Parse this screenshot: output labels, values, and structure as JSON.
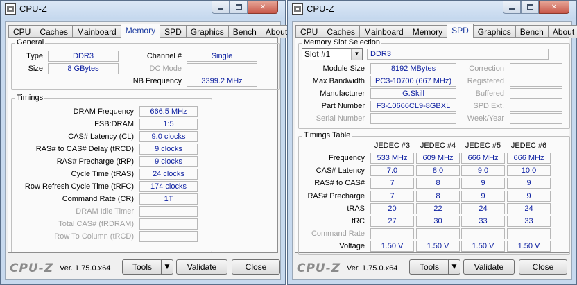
{
  "left_window": {
    "title": "CPU-Z",
    "tabs": [
      "CPU",
      "Caches",
      "Mainboard",
      "Memory",
      "SPD",
      "Graphics",
      "Bench",
      "About"
    ],
    "general": {
      "title": "General",
      "type_label": "Type",
      "type_value": "DDR3",
      "size_label": "Size",
      "size_value": "8 GBytes",
      "channel_label": "Channel #",
      "channel_value": "Single",
      "dcmode_label": "DC Mode",
      "dcmode_value": "",
      "nbfreq_label": "NB Frequency",
      "nbfreq_value": "3399.2 MHz"
    },
    "timings": {
      "title": "Timings",
      "rows": [
        {
          "label": "DRAM Frequency",
          "value": "666.5 MHz",
          "dim": false
        },
        {
          "label": "FSB:DRAM",
          "value": "1:5",
          "dim": false
        },
        {
          "label": "CAS# Latency (CL)",
          "value": "9.0 clocks",
          "dim": false
        },
        {
          "label": "RAS# to CAS# Delay (tRCD)",
          "value": "9 clocks",
          "dim": false
        },
        {
          "label": "RAS# Precharge (tRP)",
          "value": "9 clocks",
          "dim": false
        },
        {
          "label": "Cycle Time (tRAS)",
          "value": "24 clocks",
          "dim": false
        },
        {
          "label": "Row Refresh Cycle Time (tRFC)",
          "value": "174 clocks",
          "dim": false
        },
        {
          "label": "Command Rate (CR)",
          "value": "1T",
          "dim": false
        },
        {
          "label": "DRAM Idle Timer",
          "value": "",
          "dim": true
        },
        {
          "label": "Total CAS# (tRDRAM)",
          "value": "",
          "dim": true
        },
        {
          "label": "Row To Column (tRCD)",
          "value": "",
          "dim": true
        }
      ]
    },
    "footer": {
      "logo": "CPU-Z",
      "version": "Ver. 1.75.0.x64",
      "tools": "Tools",
      "validate": "Validate",
      "close": "Close"
    }
  },
  "right_window": {
    "title": "CPU-Z",
    "tabs": [
      "CPU",
      "Caches",
      "Mainboard",
      "Memory",
      "SPD",
      "Graphics",
      "Bench",
      "About"
    ],
    "slot_group": {
      "title": "Memory Slot Selection",
      "slot_selected": "Slot #1",
      "slot_type": "DDR3",
      "rows": [
        {
          "label": "Module Size",
          "value": "8192 MBytes",
          "dim": false,
          "rlabel": "Correction",
          "rvalue": ""
        },
        {
          "label": "Max Bandwidth",
          "value": "PC3-10700 (667 MHz)",
          "dim": false,
          "rlabel": "Registered",
          "rvalue": ""
        },
        {
          "label": "Manufacturer",
          "value": "G.Skill",
          "dim": false,
          "rlabel": "Buffered",
          "rvalue": ""
        },
        {
          "label": "Part Number",
          "value": "F3-10666CL9-8GBXL",
          "dim": false,
          "rlabel": "SPD Ext.",
          "rvalue": ""
        },
        {
          "label": "Serial Number",
          "value": "",
          "dim": true,
          "rlabel": "Week/Year",
          "rvalue": ""
        }
      ]
    },
    "timings_table": {
      "title": "Timings Table",
      "columns": [
        "JEDEC #3",
        "JEDEC #4",
        "JEDEC #5",
        "JEDEC #6"
      ],
      "rows": [
        {
          "label": "Frequency",
          "dim": false,
          "values": [
            "533 MHz",
            "609 MHz",
            "666 MHz",
            "666 MHz"
          ]
        },
        {
          "label": "CAS# Latency",
          "dim": false,
          "values": [
            "7.0",
            "8.0",
            "9.0",
            "10.0"
          ]
        },
        {
          "label": "RAS# to CAS#",
          "dim": false,
          "values": [
            "7",
            "8",
            "9",
            "9"
          ]
        },
        {
          "label": "RAS# Precharge",
          "dim": false,
          "values": [
            "7",
            "8",
            "9",
            "9"
          ]
        },
        {
          "label": "tRAS",
          "dim": false,
          "values": [
            "20",
            "22",
            "24",
            "24"
          ]
        },
        {
          "label": "tRC",
          "dim": false,
          "values": [
            "27",
            "30",
            "33",
            "33"
          ]
        },
        {
          "label": "Command Rate",
          "dim": true,
          "values": [
            "",
            "",
            "",
            ""
          ]
        },
        {
          "label": "Voltage",
          "dim": false,
          "values": [
            "1.50 V",
            "1.50 V",
            "1.50 V",
            "1.50 V"
          ]
        }
      ]
    },
    "footer": {
      "logo": "CPU-Z",
      "version": "Ver. 1.75.0.x64",
      "tools": "Tools",
      "validate": "Validate",
      "close": "Close"
    }
  },
  "icons": {
    "app": "cpu-z-app-icon",
    "minimize": "minimize-icon",
    "maximize": "maximize-icon",
    "close": "close-icon",
    "dropdown": "chevron-down-icon"
  },
  "colors": {
    "value_text": "#0b1ea0",
    "active_tab_text": "#1a3aa0",
    "dim_label": "#a0a0a0",
    "frame": "#c7d9ee"
  }
}
